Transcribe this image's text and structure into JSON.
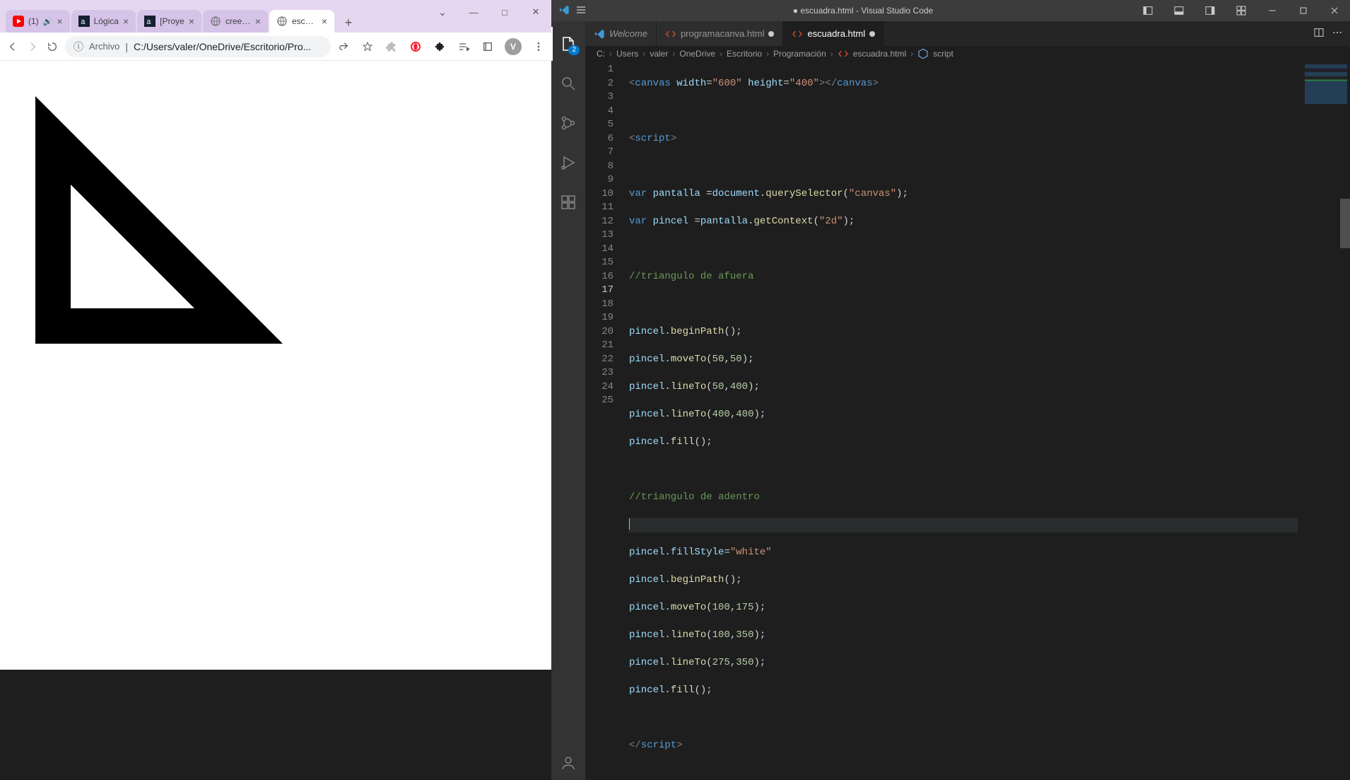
{
  "chrome": {
    "tabs": [
      {
        "title": "(1)",
        "kind": "youtube",
        "audio": true
      },
      {
        "title": "Lógica",
        "kind": "alura"
      },
      {
        "title": "[Proye",
        "kind": "alura"
      },
      {
        "title": "creepe",
        "kind": "globe"
      },
      {
        "title": "escuad",
        "kind": "globe",
        "active": true
      }
    ],
    "new_tab_plus": "+",
    "wnd_dropdown": "⌄",
    "wnd_min": "—",
    "wnd_max": "□",
    "wnd_close": "✕",
    "toolbar": {
      "info_icon": "ⓘ",
      "prefix": "Archivo",
      "separator": " | ",
      "path": "C:/Users/valer/OneDrive/Escritorio/Pro...",
      "avatar_letter": "V"
    }
  },
  "vscode": {
    "title": "● escuadra.html - Visual Studio Code",
    "tabs": {
      "welcome": "Welcome",
      "file1": "programacanva.html",
      "file2": "escuadra.html"
    },
    "activity_badge": "2",
    "breadcrumb": [
      "C:",
      "Users",
      "valer",
      "OneDrive",
      "Escritorio",
      "Programación",
      "escuadra.html",
      "script"
    ],
    "lines": {
      "l1a": "canvas",
      "l1b": "width",
      "l1c": "\"600\"",
      "l1d": "height",
      "l1e": "\"400\"",
      "l1f": "canvas",
      "l3": "script",
      "l5_var": "var",
      "l5_a": "pantalla",
      "l5_b": "document",
      "l5_c": "querySelector",
      "l5_d": "\"canvas\"",
      "l6_var": "var",
      "l6_a": "pincel",
      "l6_b": "pantalla",
      "l6_c": "getContext",
      "l6_d": "\"2d\"",
      "l8": "//triangulo de afuera",
      "l10_a": "pincel",
      "l10_b": "beginPath",
      "l11_a": "pincel",
      "l11_b": "moveTo",
      "l11_c": "50",
      "l11_d": "50",
      "l12_a": "pincel",
      "l12_b": "lineTo",
      "l12_c": "50",
      "l12_d": "400",
      "l13_a": "pincel",
      "l13_b": "lineTo",
      "l13_c": "400",
      "l13_d": "400",
      "l14_a": "pincel",
      "l14_b": "fill",
      "l16": "//triangulo de adentro",
      "l18_a": "pincel",
      "l18_b": "fillStyle",
      "l18_c": "\"white\"",
      "l19_a": "pincel",
      "l19_b": "beginPath",
      "l20_a": "pincel",
      "l20_b": "moveTo",
      "l20_c": "100",
      "l20_d": "175",
      "l21_a": "pincel",
      "l21_b": "lineTo",
      "l21_c": "100",
      "l21_d": "350",
      "l22_a": "pincel",
      "l22_b": "lineTo",
      "l22_c": "275",
      "l22_d": "350",
      "l23_a": "pincel",
      "l23_b": "fill",
      "l25": "script"
    },
    "line_numbers": [
      "1",
      "2",
      "3",
      "4",
      "5",
      "6",
      "7",
      "8",
      "9",
      "10",
      "11",
      "12",
      "13",
      "14",
      "15",
      "16",
      "17",
      "18",
      "19",
      "20",
      "21",
      "22",
      "23",
      "24",
      "25"
    ]
  }
}
